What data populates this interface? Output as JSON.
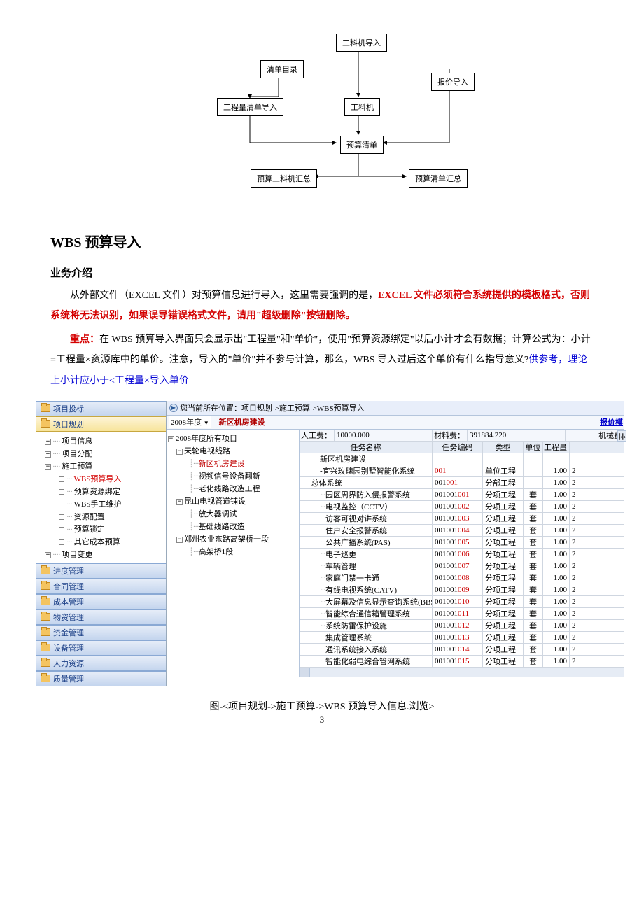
{
  "flowchart": {
    "b1": "工料机导入",
    "b2": "清单目录",
    "b3": "报价导入",
    "b4": "工程量清单导入",
    "b5": "工料机",
    "b6": "预算清单",
    "b7": "预算工料机汇总",
    "b8": "预算清单汇总"
  },
  "section_title": "WBS 预算导入",
  "sub_title": "业务介绍",
  "para1_a": "从外部文件（EXCEL 文件）对预算信息进行导入，这里需要强调的是，",
  "para1_b": "EXCEL 文件必须符合系统提供的模板格式，否则系统将无法识别，如果误导错误格式文件，请用\"超级删除\"按钮删除。",
  "para2_a": "重点：",
  "para2_b": "在 WBS 预算导入界面只会显示出\"工程量\"和\"单价\"，使用\"预算资源绑定\"以后小计才会有数据；计算公式为：小计=工程量×资源库中的单价。注意，导入的\"单价\"并不参与计算，那么，WBS 导入过后这个单价有什么指导意义?",
  "para2_c": "供参考，理论上小计应小于<工程量×导入单价",
  "nav": {
    "l0": "项目投标",
    "l1": "项目规划",
    "tree": {
      "t1": "项目信息",
      "t2": "项目分配",
      "t3": "施工预算",
      "t3a": "WBS预算导入",
      "t3b": "预算资源绑定",
      "t3c": "WBS手工维护",
      "t3d": "资源配置",
      "t3e": "预算锁定",
      "t3f": "其它成本预算",
      "t4": "项目变更"
    },
    "l2": "进度管理",
    "l3": "合同管理",
    "l4": "成本管理",
    "l5": "物资管理",
    "l6": "资金管理",
    "l7": "设备管理",
    "l8": "人力资源",
    "l9": "质量管理"
  },
  "breadcrumb": "您当前所在位置：项目规划->施工预算->WBS预算导入",
  "year": "2008年度",
  "proj_title": "新区机房建设",
  "tpl_link": "报价模",
  "btn_stub": "排",
  "proj_tree": {
    "root": "2008年度所有项目",
    "g1": "天轮电视线路",
    "g1a": "新区机房建设",
    "g1b": "视频信号设备翻新",
    "g1c": "老化线路改造工程",
    "g2": "昆山电视管道铺设",
    "g2a": "放大器调试",
    "g2b": "基础线路改造",
    "g3": "郑州农业东路高架桥一段",
    "g3a": "高架桥1段"
  },
  "summary": {
    "lab1": "人工费：",
    "val1": "10000.000",
    "lab2": "材料费：",
    "val2": "391884.220",
    "lab3": "机械费"
  },
  "headers": {
    "h1": "任务名称",
    "h2": "任务编码",
    "h3": "类型",
    "h4": "单位",
    "h5": "工程量"
  },
  "rows": [
    {
      "name": "新区机房建设",
      "code": "",
      "type": "",
      "unit": "",
      "qty": "",
      "pm": ""
    },
    {
      "name": "宜兴玫瑰园别墅智能化系统",
      "code": "001",
      "type": "单位工程",
      "unit": "",
      "qty": "1.00",
      "pm": "-",
      "red": "001"
    },
    {
      "name": "总体系统",
      "code": "001001",
      "type": "分部工程",
      "unit": "",
      "qty": "1.00",
      "pm": "-",
      "red": "001"
    },
    {
      "name": "园区周界防入侵报警系统",
      "code": "001001001",
      "type": "分项工程",
      "unit": "套",
      "qty": "1.00",
      "red": "001"
    },
    {
      "name": "电视监控（CCTV）",
      "code": "001001002",
      "type": "分项工程",
      "unit": "套",
      "qty": "1.00",
      "red": "002"
    },
    {
      "name": "访客可视对讲系统",
      "code": "001001003",
      "type": "分项工程",
      "unit": "套",
      "qty": "1.00",
      "red": "003"
    },
    {
      "name": "住户安全报警系统",
      "code": "001001004",
      "type": "分项工程",
      "unit": "套",
      "qty": "1.00",
      "red": "004"
    },
    {
      "name": "公共广播系统(PAS)",
      "code": "001001005",
      "type": "分项工程",
      "unit": "套",
      "qty": "1.00",
      "red": "005"
    },
    {
      "name": "电子巡更",
      "code": "001001006",
      "type": "分项工程",
      "unit": "套",
      "qty": "1.00",
      "red": "006"
    },
    {
      "name": "车辆管理",
      "code": "001001007",
      "type": "分项工程",
      "unit": "套",
      "qty": "1.00",
      "red": "007"
    },
    {
      "name": "家庭门禁一卡通",
      "code": "001001008",
      "type": "分项工程",
      "unit": "套",
      "qty": "1.00",
      "red": "008"
    },
    {
      "name": "有线电视系统(CATV)",
      "code": "001001009",
      "type": "分项工程",
      "unit": "套",
      "qty": "1.00",
      "red": "009"
    },
    {
      "name": "大屏幕及信息显示查询系统(BBS)",
      "code": "001001010",
      "type": "分项工程",
      "unit": "套",
      "qty": "1.00",
      "red": "010"
    },
    {
      "name": "智能综合通信箱管理系统",
      "code": "001001011",
      "type": "分项工程",
      "unit": "套",
      "qty": "1.00",
      "red": "011"
    },
    {
      "name": "系统防雷保护设施",
      "code": "001001012",
      "type": "分项工程",
      "unit": "套",
      "qty": "1.00",
      "red": "012"
    },
    {
      "name": "集成管理系统",
      "code": "001001013",
      "type": "分项工程",
      "unit": "套",
      "qty": "1.00",
      "red": "013"
    },
    {
      "name": "通讯系统接入系统",
      "code": "001001014",
      "type": "分项工程",
      "unit": "套",
      "qty": "1.00",
      "red": "014"
    },
    {
      "name": "智能化弱电综合管网系统",
      "code": "001001015",
      "type": "分项工程",
      "unit": "套",
      "qty": "1.00",
      "red": "015"
    }
  ],
  "caption": "图-<项目规划->施工预算->WBS 预算导入信息.浏览>",
  "page_num": "3"
}
